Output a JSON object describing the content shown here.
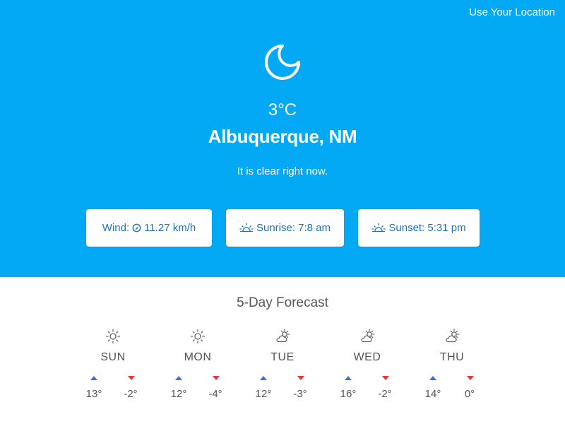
{
  "header": {
    "location_link": "Use Your Location"
  },
  "current": {
    "icon": "moon-icon",
    "temperature": "3°C",
    "city": "Albuquerque, NM",
    "description": "It is clear right now."
  },
  "stats": {
    "wind": {
      "label": "Wind:",
      "value": "11.27 km/h",
      "icon": "compass-icon"
    },
    "sunrise": {
      "text": "Sunrise: 7:8 am",
      "icon": "sunrise-icon"
    },
    "sunset": {
      "text": "Sunset: 5:31 pm",
      "icon": "sunset-icon"
    }
  },
  "forecast": {
    "title": "5-Day Forecast",
    "days": [
      {
        "day": "SUN",
        "icon": "sun-icon",
        "high": "13°",
        "low": "-2°"
      },
      {
        "day": "MON",
        "icon": "sun-icon",
        "high": "12°",
        "low": "-4°"
      },
      {
        "day": "TUE",
        "icon": "partly-cloudy-icon",
        "high": "12°",
        "low": "-3°"
      },
      {
        "day": "WED",
        "icon": "partly-cloudy-icon",
        "high": "16°",
        "low": "-2°"
      },
      {
        "day": "THU",
        "icon": "partly-cloudy-icon",
        "high": "14°",
        "low": "0°"
      }
    ]
  },
  "colors": {
    "hero_background": "#03a9f4",
    "stat_text": "#1e73be",
    "high_arrow": "#3f6fdc",
    "low_arrow": "#e53935"
  }
}
